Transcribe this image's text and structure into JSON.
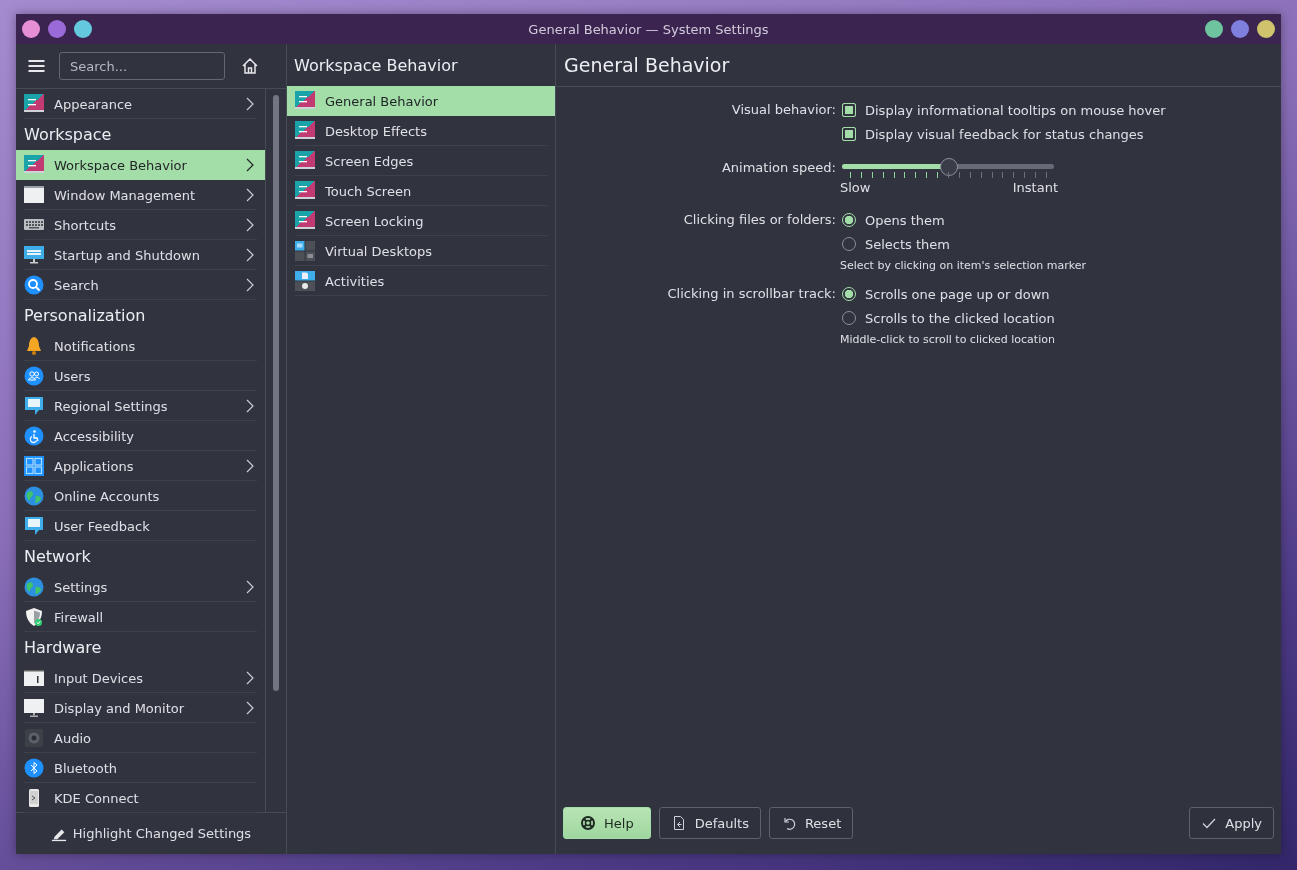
{
  "window": {
    "title": "General Behavior — System Settings"
  },
  "sidebar": {
    "search": {
      "placeholder": "Search..."
    },
    "entries": [
      {
        "kind": "item",
        "label": "Appearance",
        "has_submenu": true,
        "selected": false
      },
      {
        "kind": "header",
        "label": "Workspace"
      },
      {
        "kind": "item",
        "label": "Workspace Behavior",
        "has_submenu": true,
        "selected": true
      },
      {
        "kind": "item",
        "label": "Window Management",
        "has_submenu": true,
        "selected": false
      },
      {
        "kind": "item",
        "label": "Shortcuts",
        "has_submenu": true,
        "selected": false
      },
      {
        "kind": "item",
        "label": "Startup and Shutdown",
        "has_submenu": true,
        "selected": false
      },
      {
        "kind": "item",
        "label": "Search",
        "has_submenu": true,
        "selected": false
      },
      {
        "kind": "header",
        "label": "Personalization"
      },
      {
        "kind": "item",
        "label": "Notifications",
        "has_submenu": false,
        "selected": false
      },
      {
        "kind": "item",
        "label": "Users",
        "has_submenu": false,
        "selected": false
      },
      {
        "kind": "item",
        "label": "Regional Settings",
        "has_submenu": true,
        "selected": false
      },
      {
        "kind": "item",
        "label": "Accessibility",
        "has_submenu": false,
        "selected": false
      },
      {
        "kind": "item",
        "label": "Applications",
        "has_submenu": true,
        "selected": false
      },
      {
        "kind": "item",
        "label": "Online Accounts",
        "has_submenu": false,
        "selected": false
      },
      {
        "kind": "item",
        "label": "User Feedback",
        "has_submenu": false,
        "selected": false
      },
      {
        "kind": "header",
        "label": "Network"
      },
      {
        "kind": "item",
        "label": "Settings",
        "has_submenu": true,
        "selected": false
      },
      {
        "kind": "item",
        "label": "Firewall",
        "has_submenu": false,
        "selected": false
      },
      {
        "kind": "header",
        "label": "Hardware"
      },
      {
        "kind": "item",
        "label": "Input Devices",
        "has_submenu": true,
        "selected": false
      },
      {
        "kind": "item",
        "label": "Display and Monitor",
        "has_submenu": true,
        "selected": false
      },
      {
        "kind": "item",
        "label": "Audio",
        "has_submenu": false,
        "selected": false
      },
      {
        "kind": "item",
        "label": "Bluetooth",
        "has_submenu": false,
        "selected": false
      },
      {
        "kind": "item",
        "label": "KDE Connect",
        "has_submenu": false,
        "selected": false
      }
    ],
    "footer_button": "Highlight Changed Settings"
  },
  "subpanel": {
    "title": "Workspace Behavior",
    "items": [
      {
        "label": "General Behavior",
        "selected": true
      },
      {
        "label": "Desktop Effects",
        "selected": false
      },
      {
        "label": "Screen Edges",
        "selected": false
      },
      {
        "label": "Touch Screen",
        "selected": false
      },
      {
        "label": "Screen Locking",
        "selected": false
      },
      {
        "label": "Virtual Desktops",
        "selected": false
      },
      {
        "label": "Activities",
        "selected": false
      }
    ]
  },
  "content": {
    "title": "General Behavior",
    "visual_behavior": {
      "label": "Visual behavior:",
      "options": [
        {
          "label": "Display informational tooltips on mouse hover",
          "checked": true
        },
        {
          "label": "Display visual feedback for status changes",
          "checked": true
        }
      ]
    },
    "animation_speed": {
      "label": "Animation speed:",
      "level": 0.5,
      "min_label": "Slow",
      "max_label": "Instant"
    },
    "clicking_files": {
      "label": "Clicking files or folders:",
      "options": [
        {
          "label": "Opens them",
          "selected": true
        },
        {
          "label": "Selects them",
          "selected": false
        }
      ],
      "hint": "Select by clicking on item's selection marker"
    },
    "scrollbar_track": {
      "label": "Clicking in scrollbar track:",
      "options": [
        {
          "label": "Scrolls one page up or down",
          "selected": true
        },
        {
          "label": "Scrolls to the clicked location",
          "selected": false
        }
      ],
      "hint": "Middle-click to scroll to clicked location"
    }
  },
  "buttons": [
    {
      "kind": "help",
      "label": "Help",
      "highlighted": true
    },
    {
      "kind": "defaults",
      "label": "Defaults",
      "highlighted": false
    },
    {
      "kind": "reset",
      "label": "Reset",
      "highlighted": false
    },
    {
      "kind": "apply",
      "label": "Apply",
      "highlighted": false
    }
  ]
}
